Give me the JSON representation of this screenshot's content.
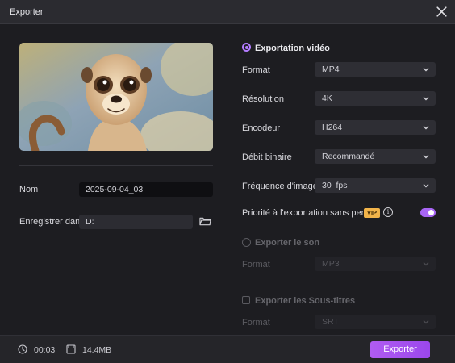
{
  "window": {
    "title": "Exporter"
  },
  "left": {
    "name_label": "Nom",
    "name_value": "2025-09-04_03",
    "save_label": "Enregistrer dans",
    "save_value": "D:"
  },
  "video": {
    "heading": "Exportation vidéo",
    "rows": [
      {
        "label": "Format",
        "value": "MP4"
      },
      {
        "label": "Résolution",
        "value": "4K"
      },
      {
        "label": "Encodeur",
        "value": "H264"
      },
      {
        "label": "Débit binaire",
        "value": "Recommandé"
      },
      {
        "label": "Fréquence d'image",
        "value": "30  fps"
      }
    ],
    "lossless_label": "Priorité à l'exportation sans perte",
    "vip_badge": "VIP",
    "lossless_enabled": true
  },
  "audio": {
    "heading": "Exporter le son",
    "format_label": "Format",
    "format_value": "MP3"
  },
  "subtitles": {
    "heading": "Exporter les Sous-titres",
    "format_label": "Format",
    "format_value": "SRT"
  },
  "footer": {
    "duration": "00:03",
    "size": "14.4MB",
    "export_label": "Exporter"
  },
  "colors": {
    "accent": "#a865f5",
    "vip": "#f2b44a",
    "background": "#1d1d21"
  }
}
